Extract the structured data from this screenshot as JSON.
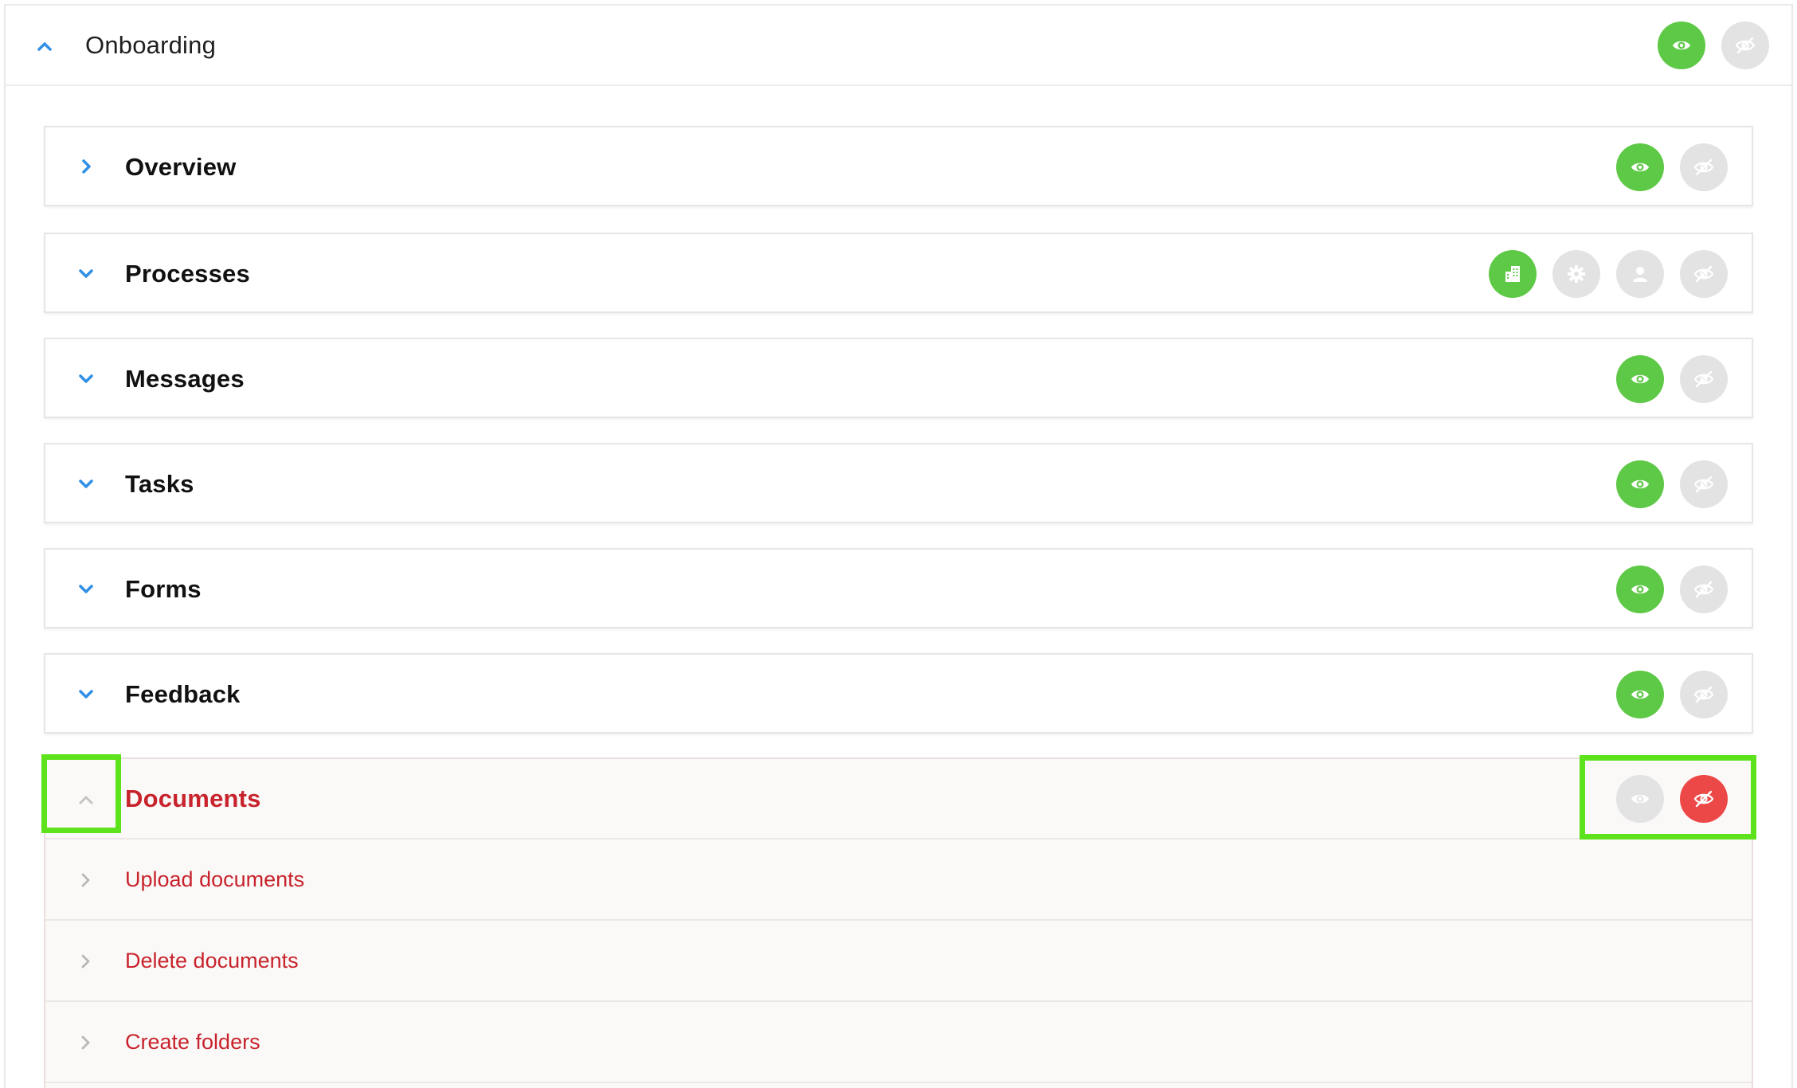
{
  "section": {
    "title": "Onboarding",
    "items": [
      {
        "title": "Overview"
      },
      {
        "title": "Processes"
      },
      {
        "title": "Messages"
      },
      {
        "title": "Tasks"
      },
      {
        "title": "Forms"
      },
      {
        "title": "Feedback"
      }
    ],
    "documents": {
      "title": "Documents",
      "children": [
        {
          "label": "Upload documents"
        },
        {
          "label": "Delete documents"
        },
        {
          "label": "Create folders"
        }
      ]
    }
  },
  "colors": {
    "accent_blue": "#2f8fe6",
    "green": "#5ec946",
    "grey": "#e3e3e3",
    "red": "#ec4848",
    "doc_text": "#c8232c",
    "highlight": "#5ee21b"
  },
  "icons": [
    "chevron-up-icon",
    "chevron-right-icon",
    "chevron-down-icon",
    "eye-icon",
    "eye-off-icon",
    "building-icon",
    "gear-icon",
    "person-icon"
  ]
}
